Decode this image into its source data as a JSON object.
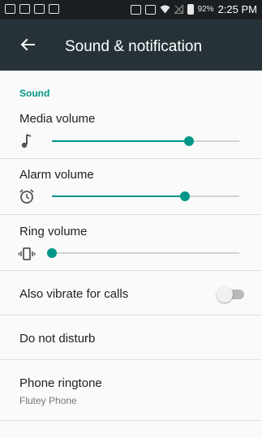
{
  "status_bar": {
    "battery_percent": "92%",
    "time": "2:25 PM",
    "icons": [
      "messaging-icon",
      "mail-icon",
      "image-icon",
      "cast-icon",
      "nfc-icon",
      "vibrate-icon",
      "wifi-icon",
      "signal-icon",
      "battery-icon"
    ]
  },
  "app_bar": {
    "back_icon": "arrow-back-icon",
    "title": "Sound & notification"
  },
  "section": {
    "header": "Sound"
  },
  "volumes": [
    {
      "label": "Media volume",
      "icon": "music-note-icon",
      "level": 0.73
    },
    {
      "label": "Alarm volume",
      "icon": "alarm-icon",
      "level": 0.71
    },
    {
      "label": "Ring volume",
      "icon": "vibrate-icon",
      "level": 0.0
    }
  ],
  "vibrate": {
    "label": "Also vibrate for calls",
    "enabled": false
  },
  "dnd": {
    "label": "Do not disturb"
  },
  "ringtone": {
    "label": "Phone ringtone",
    "value": "Flutey Phone"
  },
  "colors": {
    "accent": "#009688",
    "app_bar": "#263238",
    "status_bar": "#1b1f21"
  }
}
